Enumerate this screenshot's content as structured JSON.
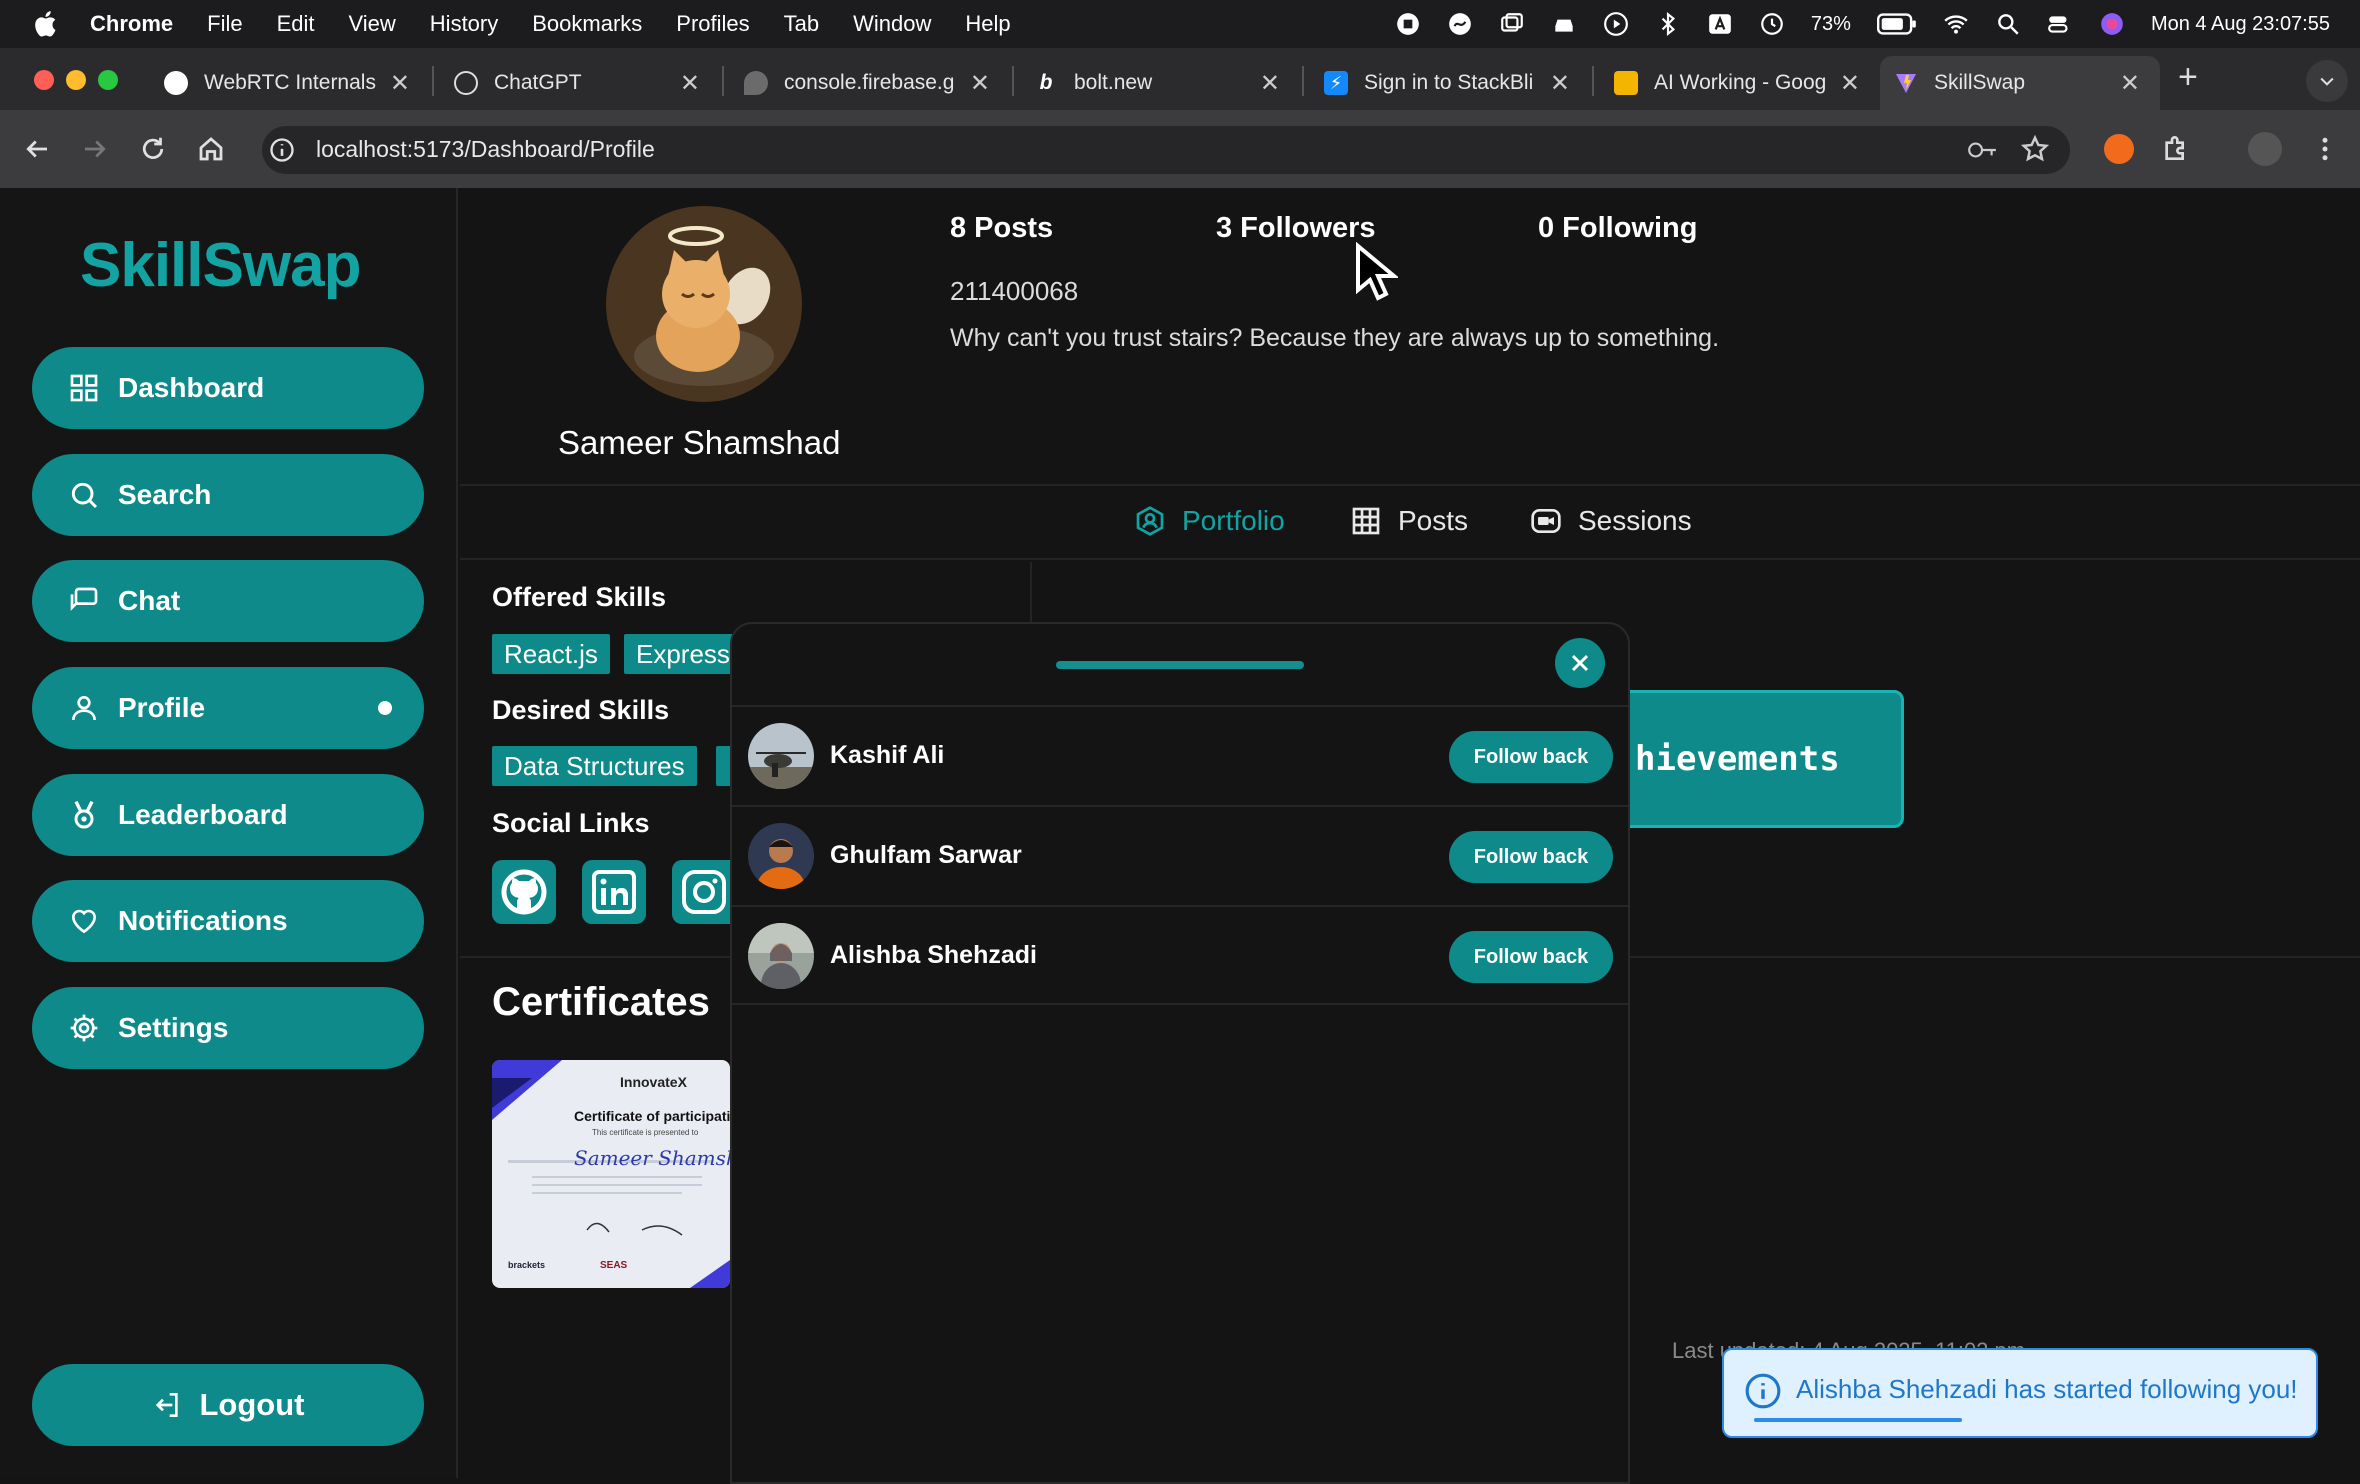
{
  "menubar": {
    "app": "Chrome",
    "items": [
      "File",
      "Edit",
      "View",
      "History",
      "Bookmarks",
      "Profiles",
      "Tab",
      "Window",
      "Help"
    ],
    "battery": "73%",
    "clock": "Mon 4 Aug  23:07:55"
  },
  "tabs": [
    {
      "title": "WebRTC Internals",
      "icon": "globe-icon"
    },
    {
      "title": "ChatGPT",
      "icon": "openai-icon"
    },
    {
      "title": "console.firebase.g",
      "icon": "firebase-icon"
    },
    {
      "title": "bolt.new",
      "icon": "bolt-icon"
    },
    {
      "title": "Sign in to StackBli",
      "icon": "stackblitz-icon"
    },
    {
      "title": "AI Working - Goog",
      "icon": "slides-icon"
    },
    {
      "title": "SkillSwap",
      "icon": "vite-icon",
      "active": true
    }
  ],
  "address": {
    "url": "localhost:5173/Dashboard/Profile"
  },
  "app": {
    "logo": "SkillSwap",
    "nav": [
      {
        "label": "Dashboard",
        "icon": "grid-icon"
      },
      {
        "label": "Search",
        "icon": "search-icon"
      },
      {
        "label": "Chat",
        "icon": "chat-icon"
      },
      {
        "label": "Profile",
        "icon": "user-icon",
        "active": true
      },
      {
        "label": "Leaderboard",
        "icon": "medal-icon"
      },
      {
        "label": "Notifications",
        "icon": "heart-icon"
      },
      {
        "label": "Settings",
        "icon": "gear-icon"
      }
    ],
    "logout": "Logout"
  },
  "profile": {
    "name": "Sameer Shamshad",
    "posts": "8 Posts",
    "followers": "3 Followers",
    "following": "0 Following",
    "uid": "211400068",
    "bio": "Why can't you trust stairs? Because they are always up to something.",
    "tabs": [
      {
        "label": "Portfolio",
        "icon": "portfolio-icon",
        "active": true
      },
      {
        "label": "Posts",
        "icon": "grid-icon"
      },
      {
        "label": "Sessions",
        "icon": "video-icon"
      }
    ],
    "offered_title": "Offered Skills",
    "offered": [
      "React.js",
      "Express"
    ],
    "desired_title": "Desired Skills",
    "desired": [
      "Data Structures"
    ],
    "social_title": "Social Links",
    "certificates_title": "Certificates",
    "achievements_label": "hievements",
    "last_updated": "Last updated: 4 Aug 2025, 11:02 pm"
  },
  "certificate": {
    "brand": "InnovateX",
    "heading": "Certificate of participation",
    "sub": "This certificate is presented to",
    "name": "Sameer Shamshad",
    "logo_a": "brackets",
    "logo_b": "SEAS"
  },
  "followers_modal": {
    "button_label": "Follow back",
    "items": [
      {
        "name": "Kashif Ali"
      },
      {
        "name": "Ghulfam Sarwar"
      },
      {
        "name": "Alishba Shehzadi"
      }
    ]
  },
  "toast": {
    "message": "Alishba Shehzadi has started following you!"
  },
  "colors": {
    "accent": "#0e8a8a",
    "logo": "#14a3a3",
    "toast_bg": "#dff0ff",
    "toast_text": "#1f77c9"
  }
}
